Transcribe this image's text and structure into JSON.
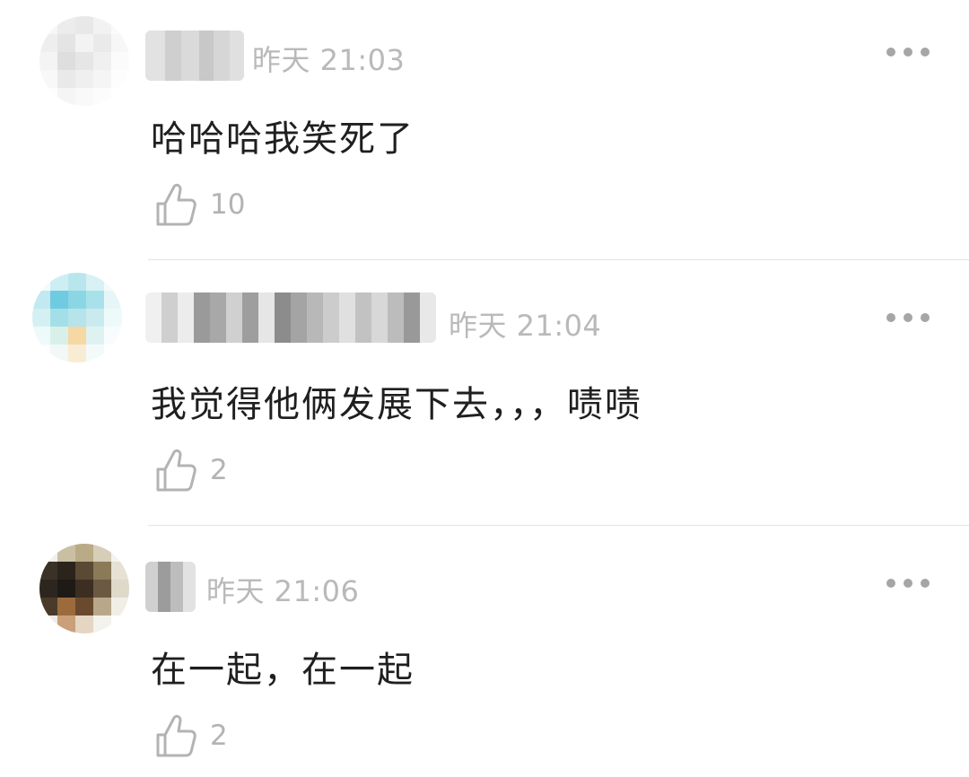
{
  "comments": [
    {
      "username": "",
      "timestamp": "昨天 21:03",
      "text": "哈哈哈我笑死了",
      "like_count": "10"
    },
    {
      "username": "",
      "timestamp": "昨天 21:04",
      "text": "我觉得他俩发展下去，，，啧啧",
      "like_count": "2"
    },
    {
      "username": "",
      "timestamp": "昨天 21:06",
      "text": "在一起，在一起",
      "like_count": "2"
    }
  ],
  "icons": {
    "like": "thumbs-up-outline-icon",
    "more": "more-horizontal-icon"
  },
  "colors": {
    "timestamp": "#b9b9b9",
    "body_text": "#1f1f1f",
    "like_icon": "#b3b3b3",
    "divider": "#e3e3e3"
  }
}
